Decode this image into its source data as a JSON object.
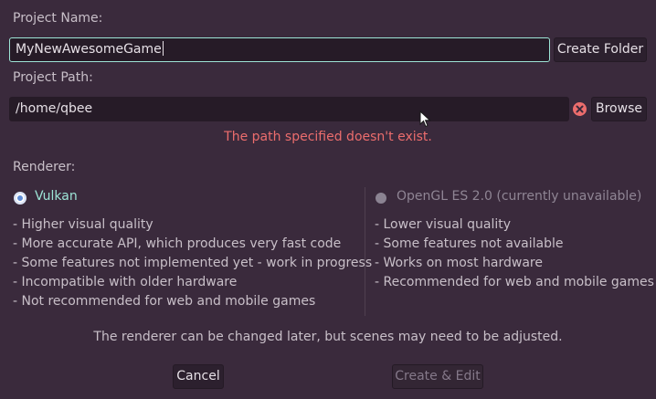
{
  "project_name": {
    "label": "Project Name:",
    "value": "MyNewAwesomeGame",
    "create_folder_label": "Create Folder"
  },
  "project_path": {
    "label": "Project Path:",
    "value": "/home/qbee",
    "browse_label": "Browse",
    "error_icon": "error-x-icon",
    "error_message": "The path specified doesn't exist."
  },
  "renderer": {
    "label": "Renderer:",
    "options": [
      {
        "name": "Vulkan",
        "selected": true,
        "features": [
          "- Higher visual quality",
          "- More accurate API, which produces very fast code",
          "- Some features not implemented yet - work in progress",
          "- Incompatible with older hardware",
          "- Not recommended for web and mobile games"
        ]
      },
      {
        "name": "OpenGL ES 2.0 (currently unavailable)",
        "selected": false,
        "features": [
          "- Lower visual quality",
          "- Some features not available",
          "- Works on most hardware",
          "- Recommended for web and mobile games"
        ]
      }
    ],
    "note": "The renderer can be changed later, but scenes may need to be adjusted."
  },
  "footer": {
    "cancel_label": "Cancel",
    "create_edit_label": "Create & Edit"
  },
  "colors": {
    "background": "#3a2a3c",
    "field_bg": "#261b27",
    "focus_border": "#9de4d6",
    "error": "#ec6d6d",
    "selected_text": "#9de4d6"
  }
}
